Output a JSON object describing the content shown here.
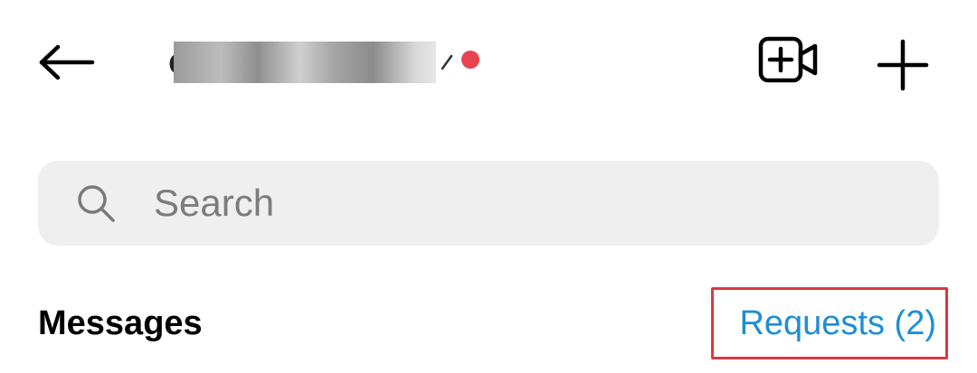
{
  "header": {
    "back_icon": "arrow-left-icon",
    "username": "c",
    "username_redacted": true,
    "chevron_icon": "chevron-down-icon",
    "notification_dot_color": "#e8434f",
    "video_icon": "video-camera-plus-icon",
    "new_message_icon": "plus-icon"
  },
  "search": {
    "placeholder": "Search",
    "value": "",
    "icon": "search-icon"
  },
  "messages_section": {
    "title": "Messages",
    "requests_label": "Requests (2)",
    "requests_color": "#1d8ed6",
    "highlight_color": "#d9393f"
  }
}
